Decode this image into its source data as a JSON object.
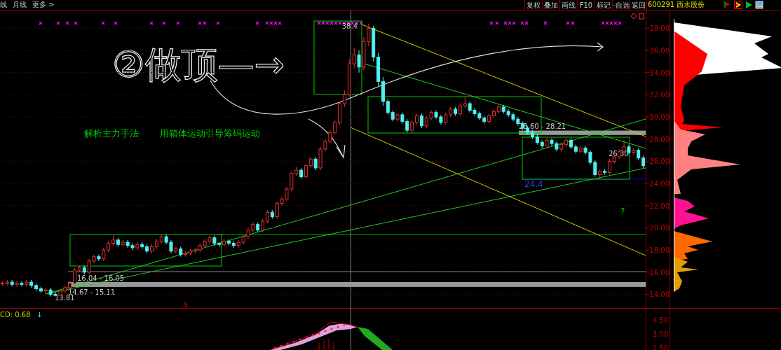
{
  "toolbar": {
    "period_tabs": [
      "线",
      "月线",
      "更多 >"
    ],
    "buttons": [
      "复权",
      "叠加",
      "画线",
      "F10",
      "标记",
      "-自选",
      "返回"
    ],
    "stock": "600291 西水股份"
  },
  "price_chart": {
    "levels": [
      {
        "kind": "band",
        "label": "28.60 - 28.21"
      },
      {
        "kind": "band",
        "label": "14.67 - 15.11"
      },
      {
        "kind": "range",
        "label": "16.04 - 16.05"
      },
      {
        "kind": "support",
        "label": "24.4"
      }
    ],
    "chart_data": {
      "type": "candlestick",
      "grid": true,
      "ylim": [
        8.98,
        39.6
      ],
      "yticks": [
        {
          "value": 38,
          "label": "38.00"
        },
        {
          "value": 36,
          "label": "36.00"
        },
        {
          "value": 34,
          "label": "34.00"
        },
        {
          "value": 32,
          "label": "32.00"
        },
        {
          "value": 30,
          "label": "30.00"
        },
        {
          "value": 28,
          "label": "28.00"
        },
        {
          "value": 26,
          "label": "26.00"
        },
        {
          "value": 24,
          "label": "24.00"
        },
        {
          "value": 22,
          "label": "22.00"
        },
        {
          "value": 20,
          "label": "20.00"
        },
        {
          "value": 18,
          "label": "18.00"
        },
        {
          "value": 16,
          "label": "16.00"
        },
        {
          "value": 14,
          "label": "14.00"
        }
      ],
      "categories": [
        null,
        null,
        null,
        null,
        null,
        null,
        null,
        null,
        null,
        null,
        null,
        null,
        null,
        null,
        null,
        null,
        null,
        null,
        null,
        null,
        null,
        null,
        null,
        null,
        null,
        null,
        null,
        null,
        null,
        null,
        null,
        null,
        null,
        null,
        null,
        null,
        null,
        null,
        null,
        null,
        null,
        null,
        null,
        null,
        null,
        null,
        null,
        null,
        null,
        null,
        null,
        null,
        null,
        null,
        null,
        null,
        null,
        null,
        null,
        null,
        null,
        null,
        null,
        null,
        null,
        null,
        null,
        null,
        null,
        null,
        null,
        null,
        null,
        null,
        null,
        null,
        null,
        null,
        null,
        null,
        null,
        null,
        null,
        null,
        null,
        null,
        null,
        null,
        null,
        null,
        null,
        null,
        null,
        null,
        null,
        null,
        null,
        null,
        null,
        null,
        null,
        null,
        null,
        null,
        null,
        null,
        null,
        null,
        null,
        null,
        null,
        null,
        null,
        null,
        null,
        null,
        null,
        null,
        null,
        null,
        null,
        null,
        null,
        null,
        null,
        null,
        null,
        null,
        null,
        null,
        null,
        null,
        null,
        null
      ],
      "ohlc": [
        [
          15.0,
          15.2,
          14.8,
          15.0
        ],
        [
          15.0,
          15.3,
          14.8,
          15.1
        ],
        [
          15.1,
          15.3,
          14.7,
          14.9
        ],
        [
          14.9,
          15.2,
          14.7,
          15.0
        ],
        [
          15.0,
          15.2,
          14.7,
          14.9
        ],
        [
          14.9,
          15.3,
          14.7,
          15.1
        ],
        [
          15.1,
          15.3,
          14.6,
          14.8
        ],
        [
          14.8,
          15.0,
          14.3,
          14.5
        ],
        [
          14.5,
          14.7,
          14.1,
          14.3
        ],
        [
          14.3,
          14.6,
          14.1,
          14.4
        ],
        [
          14.4,
          14.6,
          13.8,
          14.0
        ],
        [
          14.0,
          14.2,
          13.81,
          13.9
        ],
        [
          13.9,
          14.5,
          13.81,
          14.3
        ],
        [
          14.3,
          14.8,
          14.1,
          14.6
        ],
        [
          14.6,
          15.2,
          14.4,
          15.0
        ],
        [
          15.0,
          16.4,
          14.9,
          16.2
        ],
        [
          16.2,
          16.6,
          16.0,
          16.4
        ],
        [
          16.4,
          16.6,
          15.8,
          16.0
        ],
        [
          16.0,
          17.2,
          15.8,
          17.0
        ],
        [
          17.0,
          17.6,
          16.8,
          17.4
        ],
        [
          17.4,
          17.6,
          17.0,
          17.2
        ],
        [
          17.2,
          18.2,
          17.0,
          18.0
        ],
        [
          18.0,
          18.8,
          17.8,
          18.6
        ],
        [
          18.6,
          19.3,
          18.4,
          18.9
        ],
        [
          18.9,
          19.1,
          18.3,
          18.5
        ],
        [
          18.5,
          18.9,
          18.3,
          18.7
        ],
        [
          18.7,
          18.9,
          18.2,
          18.4
        ],
        [
          18.4,
          18.6,
          18.0,
          18.2
        ],
        [
          18.2,
          18.7,
          18.0,
          18.5
        ],
        [
          18.5,
          18.7,
          18.1,
          18.3
        ],
        [
          18.3,
          18.5,
          17.7,
          17.9
        ],
        [
          17.9,
          18.5,
          17.7,
          18.3
        ],
        [
          18.3,
          19.0,
          18.1,
          18.8
        ],
        [
          18.8,
          19.4,
          18.6,
          19.2
        ],
        [
          19.2,
          19.4,
          18.5,
          18.7
        ],
        [
          18.7,
          18.9,
          17.7,
          17.9
        ],
        [
          17.9,
          18.3,
          17.7,
          18.1
        ],
        [
          18.1,
          18.3,
          17.4,
          17.6
        ],
        [
          17.6,
          17.9,
          17.4,
          17.7
        ],
        [
          17.7,
          18.1,
          17.5,
          17.9
        ],
        [
          17.9,
          18.2,
          17.7,
          18.0
        ],
        [
          18.0,
          18.6,
          17.8,
          18.4
        ],
        [
          18.4,
          19.0,
          18.2,
          18.8
        ],
        [
          18.8,
          19.3,
          18.6,
          19.1
        ],
        [
          19.1,
          19.3,
          18.4,
          18.6
        ],
        [
          18.6,
          18.7,
          18.3,
          18.5
        ],
        [
          18.5,
          19.0,
          18.3,
          18.8
        ],
        [
          18.8,
          19.0,
          18.4,
          18.6
        ],
        [
          18.6,
          18.8,
          18.2,
          18.4
        ],
        [
          18.4,
          18.9,
          18.2,
          18.7
        ],
        [
          18.7,
          19.4,
          18.5,
          19.2
        ],
        [
          19.2,
          20.0,
          19.0,
          19.8
        ],
        [
          19.8,
          20.5,
          19.6,
          20.3
        ],
        [
          20.3,
          20.5,
          19.6,
          19.8
        ],
        [
          19.8,
          20.8,
          19.6,
          20.6
        ],
        [
          20.6,
          21.6,
          20.4,
          21.4
        ],
        [
          21.4,
          21.6,
          20.8,
          21.0
        ],
        [
          21.0,
          22.4,
          20.8,
          22.2
        ],
        [
          22.2,
          22.8,
          22.0,
          22.6
        ],
        [
          22.6,
          23.7,
          22.4,
          23.5
        ],
        [
          23.5,
          25.1,
          23.3,
          24.9
        ],
        [
          24.9,
          25.5,
          24.7,
          25.2
        ],
        [
          25.2,
          25.4,
          24.4,
          24.6
        ],
        [
          24.6,
          25.8,
          24.4,
          25.6
        ],
        [
          25.6,
          26.4,
          25.4,
          26.2
        ],
        [
          26.2,
          26.4,
          25.2,
          25.4
        ],
        [
          25.4,
          27.3,
          25.2,
          27.1
        ],
        [
          27.1,
          28.0,
          26.9,
          27.8
        ],
        [
          27.8,
          28.8,
          27.6,
          28.6
        ],
        [
          28.6,
          29.7,
          28.4,
          29.5
        ],
        [
          29.5,
          31.4,
          29.3,
          31.2
        ],
        [
          31.2,
          32.4,
          30.9,
          32.0
        ],
        [
          32.0,
          35.2,
          31.8,
          34.8
        ],
        [
          34.8,
          36.2,
          34.4,
          35.6
        ],
        [
          35.6,
          36.0,
          34.0,
          34.5
        ],
        [
          34.5,
          37.2,
          34.2,
          36.8
        ],
        [
          36.8,
          38.4,
          36.4,
          38.0
        ],
        [
          38.0,
          38.2,
          35.0,
          35.4
        ],
        [
          35.4,
          35.8,
          32.8,
          33.2
        ],
        [
          33.2,
          33.6,
          31.0,
          31.4
        ],
        [
          31.4,
          31.6,
          30.2,
          30.4
        ],
        [
          30.4,
          30.6,
          29.6,
          29.8
        ],
        [
          29.8,
          30.4,
          29.6,
          30.2
        ],
        [
          30.2,
          30.4,
          29.4,
          29.6
        ],
        [
          29.6,
          29.8,
          28.6,
          28.8
        ],
        [
          28.8,
          29.7,
          28.6,
          29.5
        ],
        [
          29.5,
          30.3,
          29.3,
          30.1
        ],
        [
          30.1,
          30.3,
          29.0,
          29.2
        ],
        [
          29.2,
          30.1,
          29.0,
          29.9
        ],
        [
          29.9,
          30.6,
          29.7,
          30.4
        ],
        [
          30.4,
          30.6,
          29.8,
          30.0
        ],
        [
          30.0,
          30.2,
          29.3,
          29.5
        ],
        [
          29.5,
          30.4,
          29.3,
          30.2
        ],
        [
          30.2,
          30.9,
          30.0,
          30.7
        ],
        [
          30.7,
          30.9,
          30.1,
          30.3
        ],
        [
          30.3,
          31.2,
          30.1,
          31.0
        ],
        [
          31.0,
          31.8,
          30.8,
          31.2
        ],
        [
          31.2,
          31.4,
          30.4,
          30.6
        ],
        [
          30.6,
          30.8,
          30.1,
          30.3
        ],
        [
          30.3,
          30.5,
          29.7,
          29.9
        ],
        [
          29.9,
          30.1,
          29.4,
          29.6
        ],
        [
          29.6,
          30.3,
          29.4,
          30.1
        ],
        [
          30.1,
          30.7,
          29.9,
          30.5
        ],
        [
          30.5,
          31.1,
          30.3,
          30.9
        ],
        [
          30.9,
          31.1,
          30.3,
          30.5
        ],
        [
          30.5,
          30.7,
          30.0,
          30.2
        ],
        [
          30.2,
          30.4,
          29.6,
          29.8
        ],
        [
          29.8,
          30.0,
          29.2,
          29.4
        ],
        [
          29.4,
          29.6,
          28.8,
          29.0
        ],
        [
          29.0,
          29.2,
          28.4,
          28.6
        ],
        [
          28.6,
          28.8,
          28.0,
          28.2
        ],
        [
          28.2,
          28.4,
          27.5,
          27.7
        ],
        [
          27.7,
          27.9,
          27.2,
          27.4
        ],
        [
          27.4,
          28.1,
          27.2,
          27.9
        ],
        [
          27.9,
          28.1,
          27.4,
          27.6
        ],
        [
          27.6,
          27.8,
          26.9,
          27.1
        ],
        [
          27.1,
          27.7,
          26.9,
          27.5
        ],
        [
          27.5,
          28.1,
          27.3,
          27.9
        ],
        [
          27.9,
          28.1,
          27.1,
          27.3
        ],
        [
          27.3,
          27.5,
          26.7,
          26.9
        ],
        [
          26.9,
          27.4,
          26.7,
          27.2
        ],
        [
          27.2,
          27.4,
          26.6,
          26.8
        ],
        [
          26.8,
          27.0,
          25.7,
          25.9
        ],
        [
          25.9,
          26.1,
          24.6,
          24.8
        ],
        [
          24.8,
          25.3,
          24.4,
          25.1
        ],
        [
          25.1,
          25.3,
          24.8,
          25.0
        ],
        [
          25.0,
          26.2,
          24.8,
          26.0
        ],
        [
          26.0,
          26.6,
          25.8,
          26.4
        ],
        [
          26.4,
          27.1,
          26.2,
          26.9
        ],
        [
          26.9,
          27.9,
          26.7,
          27.3
        ],
        [
          27.3,
          27.5,
          26.6,
          26.8
        ],
        [
          26.8,
          27.2,
          26.6,
          27.0
        ],
        [
          27.0,
          27.2,
          26.1,
          26.3
        ],
        [
          26.3,
          26.5,
          25.4,
          25.6
        ]
      ]
    },
    "handwriting": "②做顶—→",
    "captions": [
      "解析主力手法",
      "用箱体运动引导筹码运动"
    ],
    "annotations": [
      {
        "kind": "high",
        "text": "38.4"
      },
      {
        "kind": "last",
        "text": "26.30"
      },
      {
        "kind": "low",
        "text": "13.81"
      }
    ],
    "question": "?",
    "signal": "$"
  },
  "indicator": {
    "title": "CD: 0.68",
    "arrow": "↓",
    "y_axis_labels": [
      "4.50",
      "3.00",
      "1.50"
    ]
  }
}
